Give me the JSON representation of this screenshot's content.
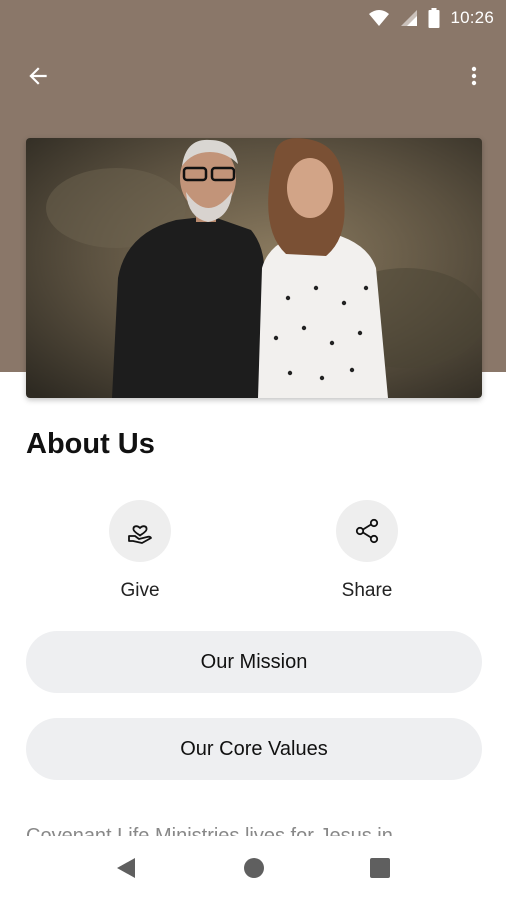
{
  "status_bar": {
    "time": "10:26",
    "icons": [
      "wifi-icon",
      "cell-signal-icon",
      "battery-icon"
    ]
  },
  "app_bar": {
    "back_icon": "arrow-left-icon",
    "menu_icon": "more-vert-icon"
  },
  "colors": {
    "header_background": "#8a7769",
    "button_background": "#eeeff1",
    "action_circle": "#eeeeee"
  },
  "hero": {
    "image": "photo of a smiling man and woman"
  },
  "page": {
    "title": "About Us"
  },
  "actions": [
    {
      "label": "Give",
      "icon": "hand-heart-icon"
    },
    {
      "label": "Share",
      "icon": "share-icon"
    }
  ],
  "buttons": {
    "mission": "Our Mission",
    "core_values": "Our Core Values"
  },
  "content": {
    "preview_text": "Covenant Life Ministries lives for Jesus in"
  },
  "nav_bar": {
    "icons": [
      "nav-back-icon",
      "nav-home-icon",
      "nav-recents-icon"
    ]
  }
}
